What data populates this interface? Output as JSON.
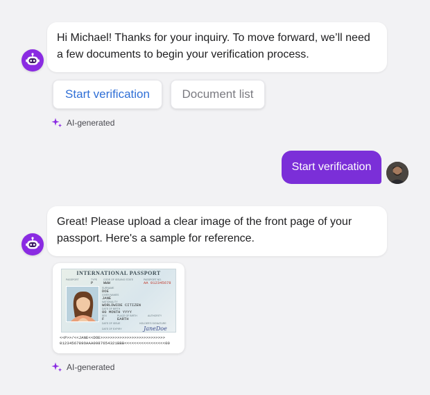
{
  "messages": {
    "bot1": {
      "text": "Hi Michael! Thanks for your inquiry. To move forward, we’ll need a few documents to begin your verification process."
    },
    "chips": {
      "start": "Start verification",
      "docs": "Document list"
    },
    "ai_tag_1": "AI-generated",
    "user1": {
      "text": "Start verification"
    },
    "bot2": {
      "text": "Great! Please upload a clear image of the front page of your passport. Here's a sample for reference."
    },
    "ai_tag_2": "AI-generated"
  },
  "passport": {
    "title": "INTERNATIONAL PASSPORT",
    "label_passport": "PASSPORT",
    "label_type": "TYPE",
    "type": "P",
    "label_code": "CODE OF ISSUING STATE",
    "code": "WWW",
    "label_number": "PASSPORT NO.",
    "number": "AA 012345678",
    "label_surname": "SURNAME",
    "surname": "DOE",
    "label_given": "GIVEN NAMES",
    "given": "JANE",
    "label_nationality": "NATIONALITY",
    "nationality": "WORLDWIDE CITIZEN",
    "label_dob": "DATE OF BIRTH",
    "dob": "00 MONTH YYYY",
    "label_sex": "SEX",
    "sex": "F",
    "label_pob": "PLACE OF BIRTH",
    "pob": "EARTH",
    "label_issue": "DATE OF ISSUE",
    "label_auth": "AUTHORITY",
    "label_holder": "HOLDER'S SIGNATURE",
    "label_expiry": "DATE OF EXPIRY",
    "signature": "JaneDoe",
    "mrz1": "<<P>>/<<JANE<<DOE>>>>>>>>>>>>>>>>>>>>>>>>>>>",
    "mrz2": "0123456789OAAA0987654321BBB<<<<<<<<<<<<<<<<<00"
  },
  "colors": {
    "accent": "#7b2fd8",
    "link": "#2f6fd6",
    "background": "#f2f2f4"
  },
  "icons": {
    "bot_avatar": "robot-icon",
    "sparkle": "sparkle-icon"
  }
}
